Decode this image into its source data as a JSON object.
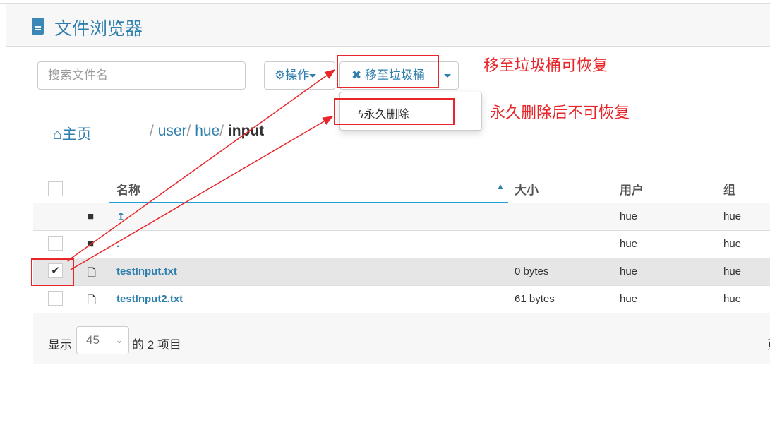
{
  "header": {
    "title": "文件浏览器",
    "icon": "file-text-icon"
  },
  "toolbar": {
    "search_placeholder": "搜索文件名",
    "actions_label": "操作",
    "trash_label": "移至垃圾桶",
    "dropdown": {
      "items": [
        {
          "label": "永久删除",
          "icon": "bolt-icon"
        }
      ]
    }
  },
  "breadcrumb": {
    "home": "主页",
    "sep": "/",
    "parts": [
      "user",
      "hue",
      "input"
    ]
  },
  "table": {
    "columns": [
      "名称",
      "大小",
      "用户",
      "组"
    ],
    "rows": [
      {
        "name": "↥",
        "size": "",
        "user": "hue",
        "group": "hue",
        "type": "folder",
        "checkbox": false,
        "checked": false
      },
      {
        "name": ".",
        "size": "",
        "user": "hue",
        "group": "hue",
        "type": "folder",
        "checkbox": true,
        "checked": false
      },
      {
        "name": "testInput.txt",
        "size": "0 bytes",
        "user": "hue",
        "group": "hue",
        "type": "file",
        "checkbox": true,
        "checked": true
      },
      {
        "name": "testInput2.txt",
        "size": "61 bytes",
        "user": "hue",
        "group": "hue",
        "type": "file",
        "checkbox": true,
        "checked": false
      }
    ]
  },
  "footer": {
    "show": "显示",
    "page_size": "45",
    "count": "的 2 项目",
    "cut_text": "页"
  },
  "annotations": {
    "trash_note": "移至垃圾桶可恢复",
    "delete_note": "永久删除后不可恢复",
    "color": "#e8262a"
  }
}
